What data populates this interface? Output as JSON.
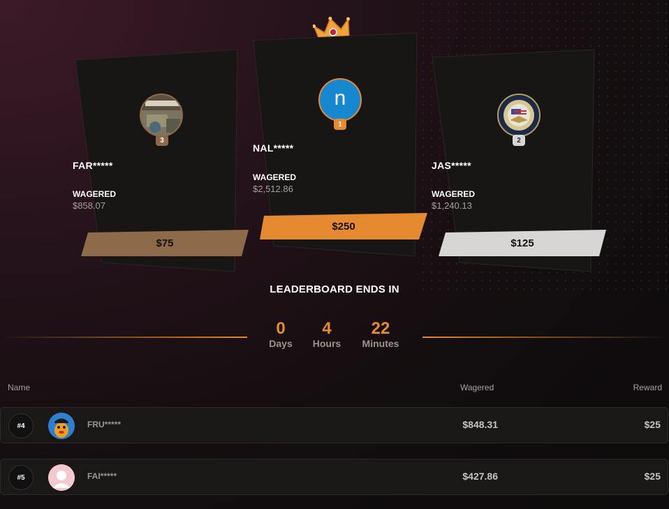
{
  "podium": [
    {
      "place": "3",
      "name": "FAR*****",
      "wagered_label": "WAGERED",
      "wagered": "$858.07",
      "prize": "$75"
    },
    {
      "place": "1",
      "name": "NAL*****",
      "wagered_label": "WAGERED",
      "wagered": "$2,512.86",
      "prize": "$250",
      "avatar_letter": "n"
    },
    {
      "place": "2",
      "name": "JAS*****",
      "wagered_label": "WAGERED",
      "wagered": "$1,240.13",
      "prize": "$125"
    }
  ],
  "countdown": {
    "title": "LEADERBOARD ENDS IN",
    "days": "0",
    "days_label": "Days",
    "hours": "4",
    "hours_label": "Hours",
    "minutes": "22",
    "minutes_label": "Minutes"
  },
  "table": {
    "headers": {
      "name": "Name",
      "wagered": "Wagered",
      "reward": "Reward"
    },
    "rows": [
      {
        "rank": "#4",
        "name": "FRU*****",
        "wagered": "$848.31",
        "reward": "$25"
      },
      {
        "rank": "#5",
        "name": "FAI*****",
        "wagered": "$427.86",
        "reward": "$25"
      }
    ]
  },
  "colors": {
    "gold": "#e68a31",
    "bronze": "#8c6a4a",
    "silver": "#d8d6d4"
  },
  "icons": {
    "crown": "crown-icon",
    "avatar_placeholder": "user-silhouette-icon"
  }
}
